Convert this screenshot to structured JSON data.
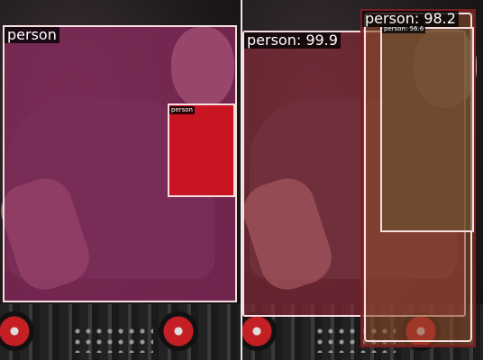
{
  "colors": {
    "mask_left_large": "#8a2a5e",
    "mask_left_small": "#d0141e",
    "mask_right_a": "#8f2a3a",
    "mask_right_b": "#8a4a2a",
    "mask_right_c": "#6b5030",
    "box_outline": "#f4dede",
    "box_dark": "#7a1e22"
  },
  "left_panel": {
    "detections": [
      {
        "label": "person"
      },
      {
        "label": "person"
      }
    ]
  },
  "right_panel": {
    "detections": [
      {
        "label": "person: 99.9"
      },
      {
        "label": "person: 98.2"
      },
      {
        "label": "person: 56.6"
      }
    ]
  }
}
